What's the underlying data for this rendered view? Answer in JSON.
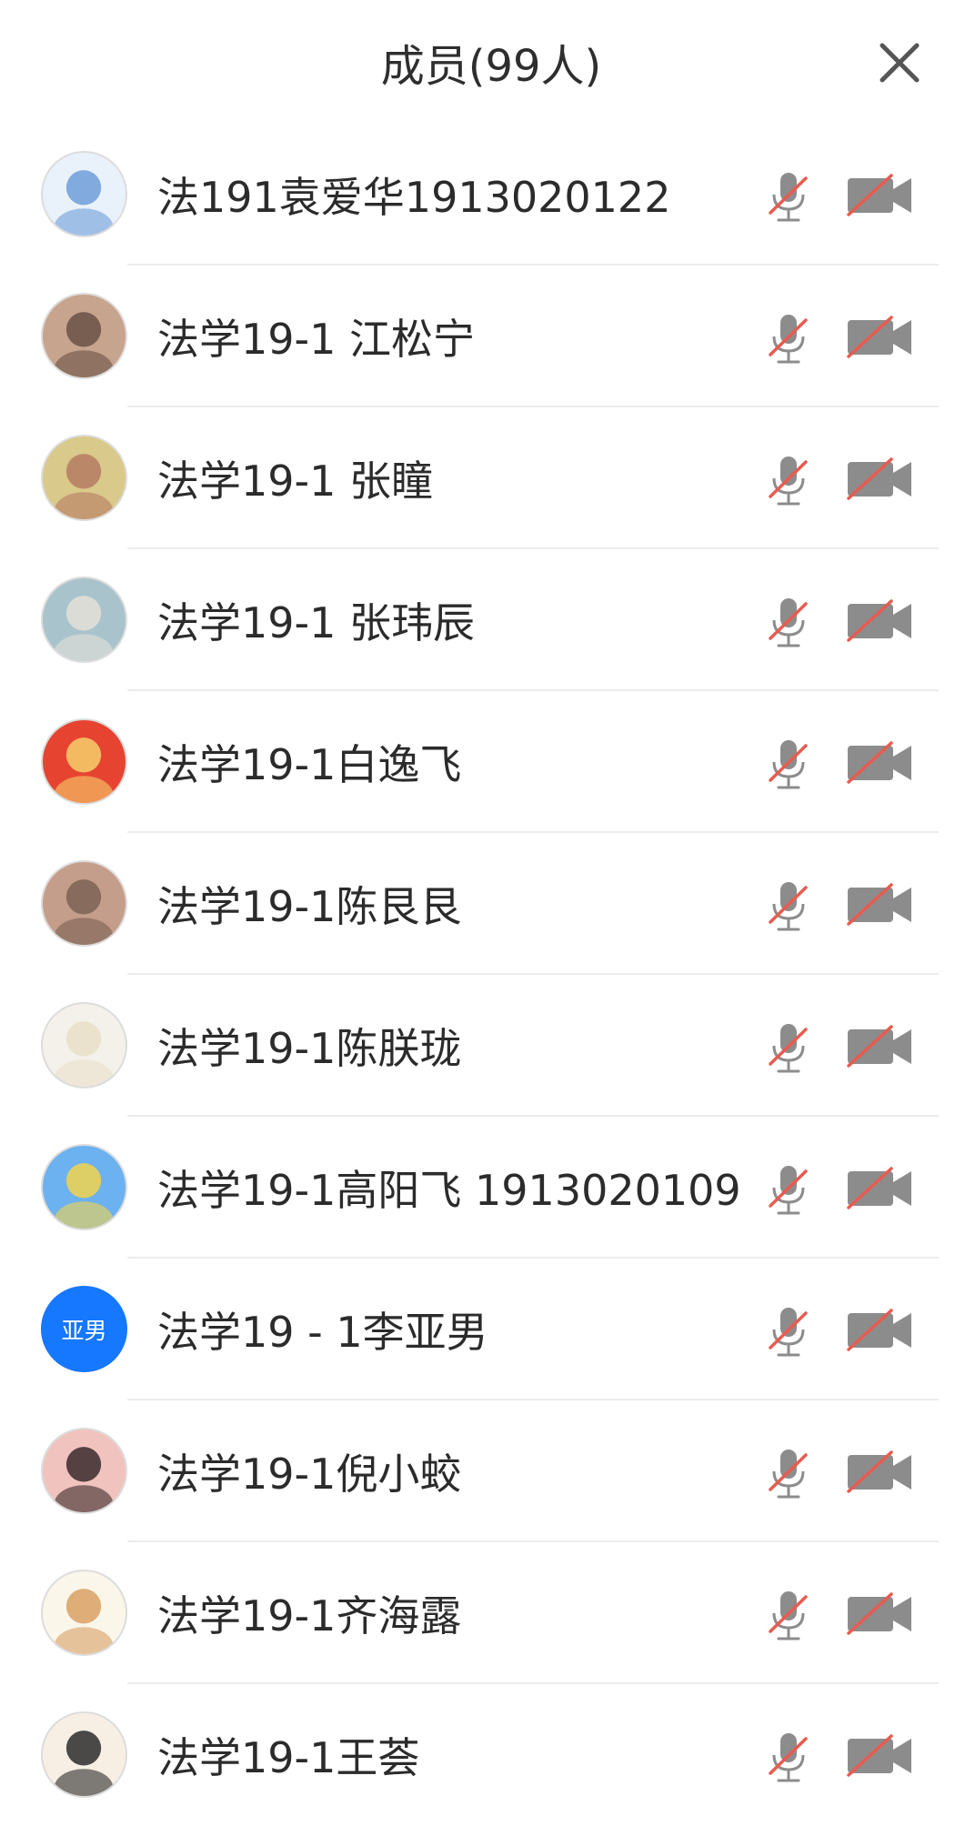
{
  "header": {
    "title": "成员(99人)",
    "close_icon": "close-icon"
  },
  "colors": {
    "icon_gray": "#8c8c8c",
    "slash_red": "#e85b4f",
    "avatar_blue": "#1677ff"
  },
  "members": [
    {
      "name": "法191袁爱华1913020122",
      "avatar": {
        "type": "image",
        "bg": "#e9f1fb",
        "fg": "#6f9ed9"
      }
    },
    {
      "name": "法学19-1 江松宁",
      "avatar": {
        "type": "image",
        "bg": "#c7a48d",
        "fg": "#6a5146"
      }
    },
    {
      "name": "法学19-1 张瞳",
      "avatar": {
        "type": "image",
        "bg": "#d9c98a",
        "fg": "#b57b63"
      }
    },
    {
      "name": "法学19-1 张玮辰",
      "avatar": {
        "type": "image",
        "bg": "#a9c3cc",
        "fg": "#e5e1d8"
      }
    },
    {
      "name": "法学19-1白逸飞",
      "avatar": {
        "type": "image",
        "bg": "#e64431",
        "fg": "#f6cf6b"
      }
    },
    {
      "name": "法学19-1陈艮艮",
      "avatar": {
        "type": "image",
        "bg": "#c49e8a",
        "fg": "#7c6154"
      }
    },
    {
      "name": "法学19-1陈朕珑",
      "avatar": {
        "type": "image",
        "bg": "#f4f1ea",
        "fg": "#e9dfc9"
      }
    },
    {
      "name": "法学19-1高阳飞 1913020109",
      "avatar": {
        "type": "image",
        "bg": "#6cb1f0",
        "fg": "#f1d34c"
      }
    },
    {
      "name": "法学19 - 1李亚男",
      "avatar": {
        "type": "text",
        "text": "亚男",
        "bg": "#1677ff"
      }
    },
    {
      "name": "法学19-1倪小蛟",
      "avatar": {
        "type": "image",
        "bg": "#f1c3bf",
        "fg": "#3a2a2a"
      }
    },
    {
      "name": "法学19-1齐海露",
      "avatar": {
        "type": "image",
        "bg": "#fbf6ea",
        "fg": "#d8a064"
      }
    },
    {
      "name": "法学19-1王荟",
      "avatar": {
        "type": "image",
        "bg": "#f7efe4",
        "fg": "#2b2b2b"
      }
    }
  ]
}
